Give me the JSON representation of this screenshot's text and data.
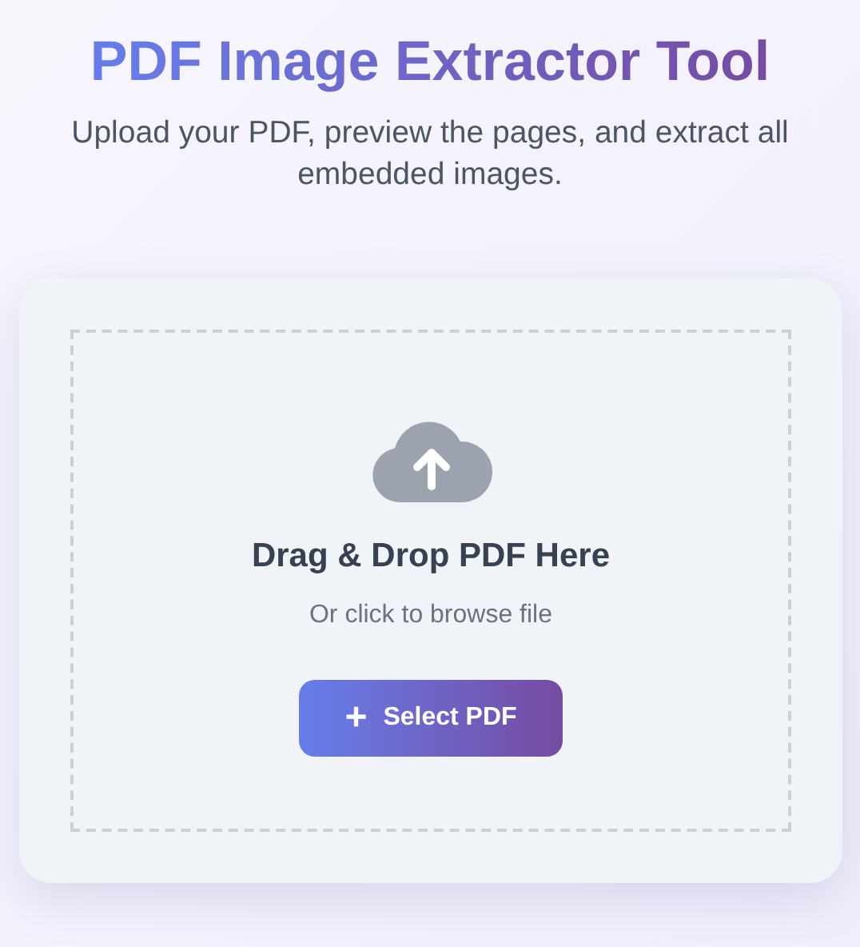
{
  "header": {
    "title": "PDF Image Extractor Tool",
    "subtitle": "Upload your PDF, preview the pages, and extract all embedded images."
  },
  "dropzone": {
    "heading": "Drag & Drop PDF Here",
    "hint": "Or click to browse file",
    "button": {
      "icon": "+",
      "label": "Select PDF"
    }
  }
}
